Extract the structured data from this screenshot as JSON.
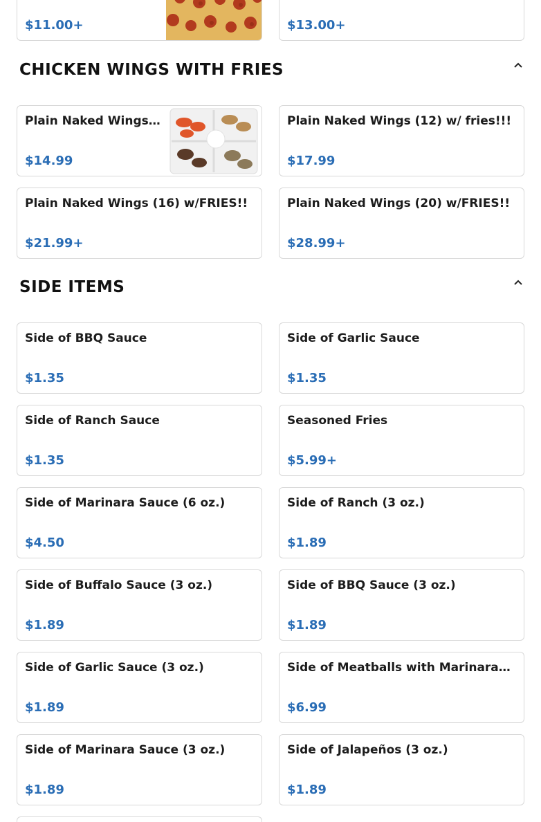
{
  "top_row": [
    {
      "price": "$11.00+",
      "image": "pepperoni-pizza"
    },
    {
      "price": "$13.00+"
    }
  ],
  "sections": [
    {
      "title": "CHICKEN WINGS WITH FRIES",
      "collapse_icon": "chevron-up-icon",
      "items": [
        {
          "name": "Plain Naked Wings…",
          "price": "$14.99",
          "image": "wings-platter"
        },
        {
          "name": "Plain Naked Wings (12) w/ fries!!!",
          "price": "$17.99"
        },
        {
          "name": "Plain Naked Wings (16) w/FRIES!!",
          "price": "$21.99+"
        },
        {
          "name": "Plain Naked Wings (20) w/FRIES!!",
          "price": "$28.99+"
        }
      ]
    },
    {
      "title": "SIDE ITEMS",
      "collapse_icon": "chevron-up-icon",
      "items": [
        {
          "name": "Side of BBQ Sauce",
          "price": "$1.35"
        },
        {
          "name": "Side of Garlic Sauce",
          "price": "$1.35"
        },
        {
          "name": "Side of Ranch Sauce",
          "price": "$1.35"
        },
        {
          "name": "Seasoned Fries",
          "price": "$5.99+"
        },
        {
          "name": "Side of Marinara Sauce (6 oz.)",
          "price": "$4.50"
        },
        {
          "name": "Side of Ranch (3 oz.)",
          "price": "$1.89"
        },
        {
          "name": "Side of Buffalo Sauce (3 oz.)",
          "price": "$1.89"
        },
        {
          "name": "Side of BBQ Sauce (3 oz.)",
          "price": "$1.89"
        },
        {
          "name": "Side of Garlic Sauce (3 oz.)",
          "price": "$1.89"
        },
        {
          "name": "Side of Meatballs with Marinara…",
          "price": "$6.99"
        },
        {
          "name": "Side of Marinara Sauce (3 oz.)",
          "price": "$1.89"
        },
        {
          "name": "Side of Jalapeños (3 oz.)",
          "price": "$1.89"
        }
      ]
    }
  ],
  "colors": {
    "price": "#2a6db5",
    "border": "#d8d8d8",
    "text": "#1c1c1c"
  }
}
